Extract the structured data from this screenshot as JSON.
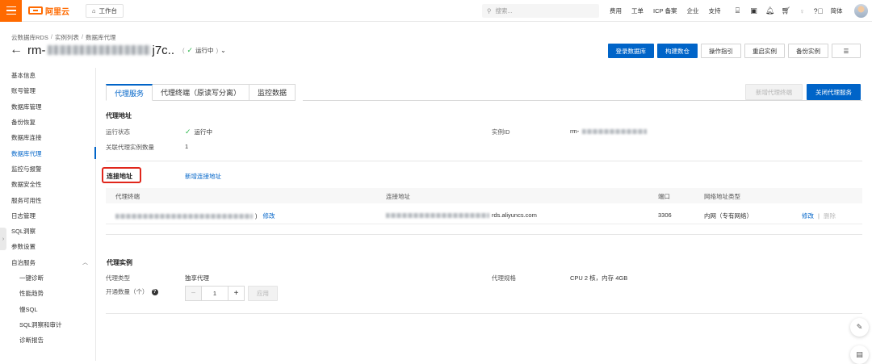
{
  "topbar": {
    "logo_text": "阿里云",
    "workbench_label": "工作台",
    "search_placeholder": "搜索...",
    "nav_text": [
      "费用",
      "工单",
      "ICP 备案",
      "企业",
      "支持"
    ],
    "lang_label": "简体"
  },
  "header": {
    "breadcrumb": [
      "云数据库RDS",
      "实例列表",
      "数据库代理"
    ],
    "instance_prefix": "rm-",
    "instance_suffix": "j7c..",
    "status": "运行中",
    "buttons": [
      "登录数据库",
      "构建数仓",
      "操作指引",
      "重启实例",
      "备份实例"
    ]
  },
  "sidebar": {
    "items": [
      "基本信息",
      "账号管理",
      "数据库管理",
      "备份恢复",
      "数据库连接",
      "数据库代理",
      "监控与报警",
      "数据安全性",
      "服务可用性",
      "日志管理",
      "SQL洞察",
      "参数设置",
      "自治服务"
    ],
    "sub_items": [
      "一键诊断",
      "性能趋势",
      "慢SQL",
      "SQL洞察和审计",
      "诊断报告"
    ],
    "active": "数据库代理"
  },
  "tabs": {
    "items": [
      "代理服务",
      "代理终端（原读写分离）",
      "监控数据"
    ],
    "active": 0,
    "new_terminal": "新增代理终端",
    "close_proxy": "关闭代理服务"
  },
  "proxy_address": {
    "title": "代理地址",
    "run_status_label": "运行状态",
    "run_status_value": "运行中",
    "instance_id_label": "实例ID",
    "instance_id_prefix": "rm-",
    "linked_count_label": "关联代理实例数量",
    "linked_count_value": "1"
  },
  "connection": {
    "title": "连接地址",
    "add_link": "新增连接地址",
    "columns": [
      "代理终端",
      "连接地址",
      "端口",
      "网络地址类型"
    ],
    "row": {
      "terminal_suffix": ")",
      "edit_inline": "修改",
      "address_suffix": "rds.aliyuncs.com",
      "port": "3306",
      "net_type": "内网（专有网络）",
      "edit": "修改",
      "delete": "删除"
    }
  },
  "proxy_instance": {
    "title": "代理实例",
    "type_label": "代理类型",
    "type_value": "独享代理",
    "spec_label": "代理规格",
    "spec_value": "CPU 2 核，内存 4GB",
    "count_label": "开通数量（个）",
    "count_value": "1",
    "apply": "应用"
  },
  "colors": {
    "brand": "#ff6a00",
    "primary": "#0064c8",
    "success": "#2db84d",
    "highlight": "#e0261b"
  }
}
